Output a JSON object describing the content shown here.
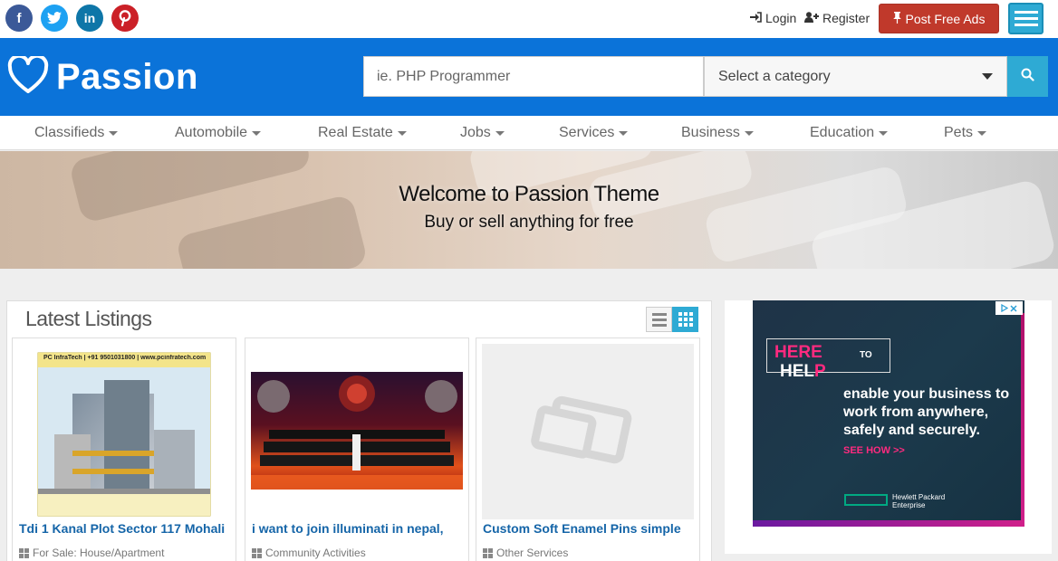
{
  "topbar": {
    "social": [
      {
        "name": "facebook",
        "glyph": "f",
        "color": "#3b5998"
      },
      {
        "name": "twitter",
        "glyph": "t",
        "color": "#1da1f2"
      },
      {
        "name": "linkedin",
        "glyph": "in",
        "color": "#0e76a8"
      },
      {
        "name": "pinterest",
        "glyph": "p",
        "color": "#cb2027"
      }
    ],
    "login_label": "Login",
    "register_label": "Register",
    "post_label": "Post Free Ads"
  },
  "header": {
    "logo_text": "Passion",
    "search_placeholder": "ie. PHP Programmer",
    "category_placeholder": "Select a category",
    "accent": "#0b73d9"
  },
  "nav": {
    "items": [
      "Classifieds",
      "Automobile",
      "Real Estate",
      "Jobs",
      "Services",
      "Business",
      "Education",
      "Pets"
    ]
  },
  "hero": {
    "title": "Welcome to Passion Theme",
    "subtitle": "Buy or sell anything for free"
  },
  "listings": {
    "title": "Latest Listings",
    "cards": [
      {
        "title": "Tdi 1 Kanal Plot Sector 117 Mohali",
        "category": "For Sale: House/Apartment",
        "image_caption": "PC InfraTech | +91 9501031800 | www.pcinfratech.com"
      },
      {
        "title": "i want to join illuminati in nepal,",
        "category": "Community Activities"
      },
      {
        "title": "Custom Soft Enamel Pins simple",
        "category": "Other Services"
      }
    ]
  },
  "ad": {
    "here": "HERE",
    "to": "TO",
    "help_a": "HEL",
    "help_b": "P",
    "text": "enable your business to work from anywhere, safely and securely.",
    "see_how": "SEE HOW >>",
    "brand": "Hewlett Packard Enterprise"
  }
}
